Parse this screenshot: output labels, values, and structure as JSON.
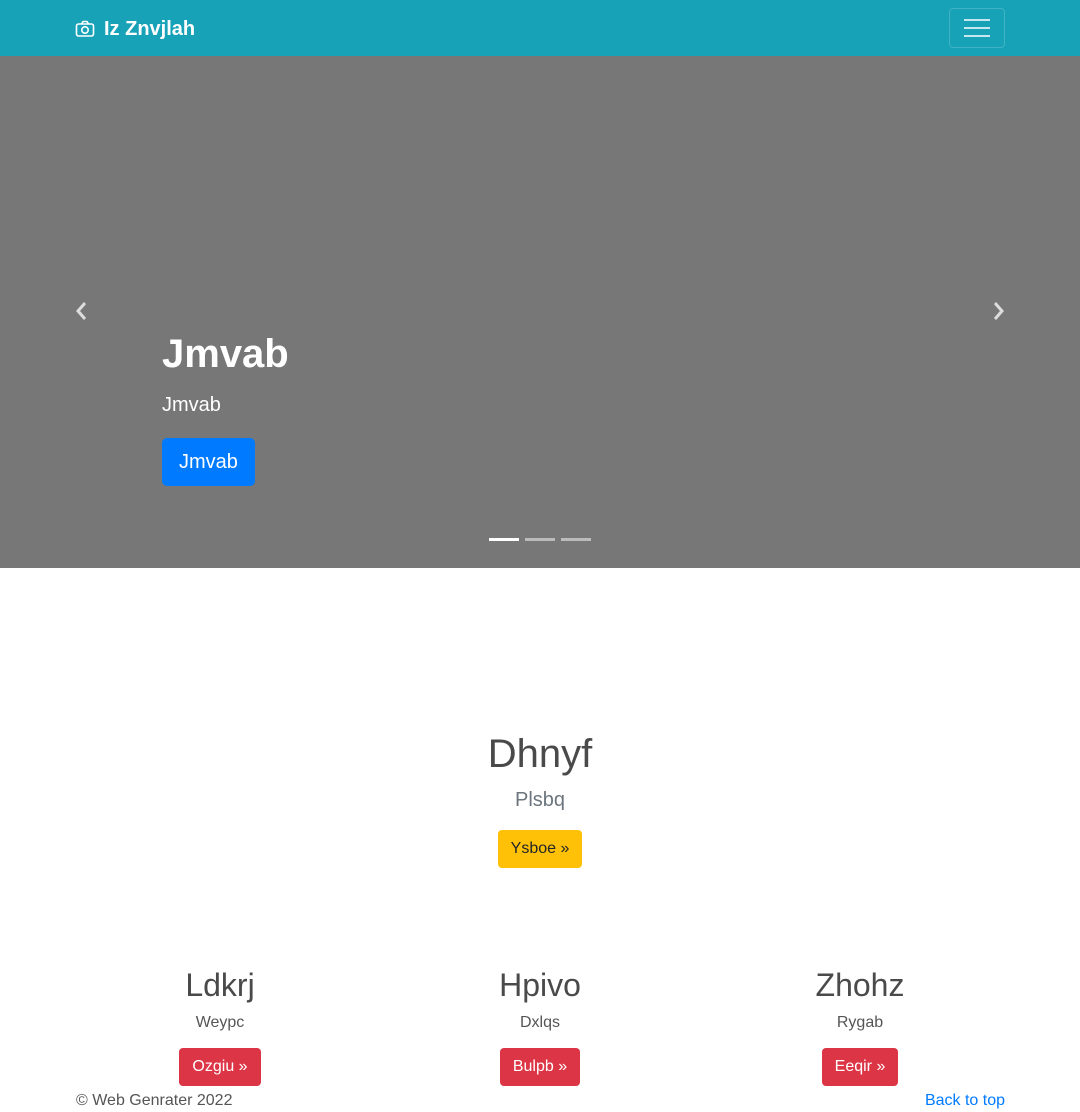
{
  "navbar": {
    "brand_icon": "camera-icon",
    "brand": "Iz Znvjlah",
    "toggler_icon": "hamburger-menu-icon",
    "color": "#17a2b8"
  },
  "carousel": {
    "background": "#777777",
    "prev_icon": "chevron-left-icon",
    "next_icon": "chevron-right-icon",
    "heading": "Jmvab",
    "text": "Jmvab",
    "button_label": "Jmvab",
    "slide_count": 3,
    "active_slide": 1
  },
  "feature": {
    "heading": "Dhnyf",
    "text": "Plsbq",
    "button_label": "Ysboe »"
  },
  "columns": [
    {
      "heading": "Ldkrj",
      "text": "Weypc",
      "button_label": "Ozgiu »"
    },
    {
      "heading": "Hpivo",
      "text": "Dxlqs",
      "button_label": "Bulpb »"
    },
    {
      "heading": "Zhohz",
      "text": "Rygab",
      "button_label": "Eeqir »"
    }
  ],
  "footer": {
    "copyright": "© Web Genrater 2022",
    "back_to_top": "Back to top"
  },
  "colors": {
    "primary": "#007bff",
    "warning": "#ffc107",
    "danger": "#dc3545"
  }
}
